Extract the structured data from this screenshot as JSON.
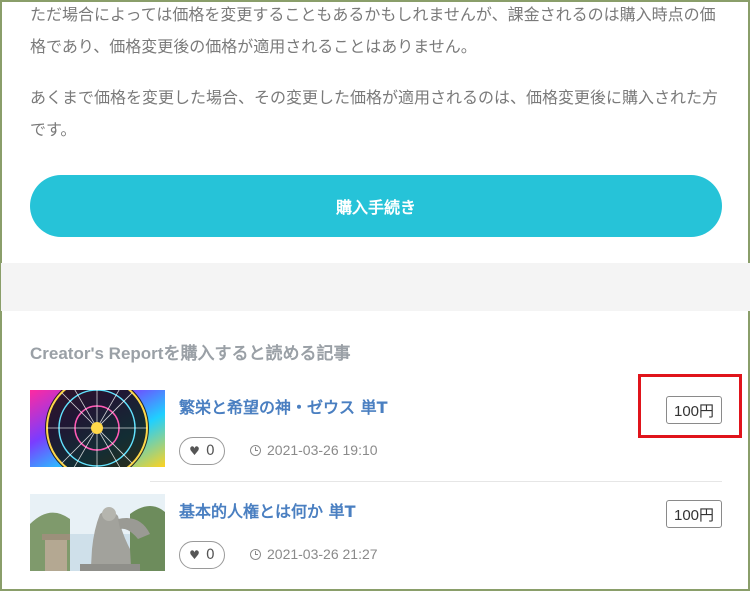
{
  "intro": {
    "paragraph1": "ただ場合によっては価格を変更することもあるかもしれませんが、課金されるのは購入時点の価格であり、価格変更後の価格が適用されることはありません。",
    "paragraph2": "あくまで価格を変更した場合、その変更した価格が適用されるのは、価格変更後に購入された方です。"
  },
  "purchase_button": {
    "label": "購入手続き"
  },
  "colors": {
    "accent": "#26c3d8",
    "highlight": "#e0141b",
    "link": "#4a7fc1"
  },
  "section": {
    "title": "Creator's Reportを購入すると読める記事"
  },
  "articles": [
    {
      "title": "繁栄と希望の神・ゼウス 単T",
      "likes": "0",
      "date": "2021-03-26 19:10",
      "price": "100円",
      "thumb_icon": "zodiac-wheel-image"
    },
    {
      "title": "基本的人権とは何か 単T",
      "likes": "0",
      "date": "2021-03-26 21:27",
      "price": "100円",
      "thumb_icon": "statue-image"
    }
  ]
}
